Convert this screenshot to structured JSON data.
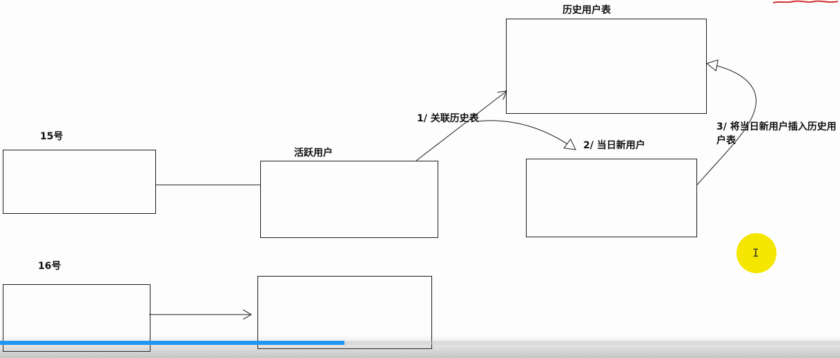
{
  "diagram": {
    "labels": {
      "day15": "15号",
      "day16": "16号",
      "active_users": "活跃用户",
      "history_table": "历史用户表",
      "step1": "1/ 关联历史表",
      "step2": "2/ 当日新用户",
      "step3": "3/ 将当日新用户插入历史用户表"
    },
    "colors": {
      "line": "#1a1a1a",
      "cursor_highlight": "#f5e600",
      "progress": "#2196f3",
      "corner_mark": "#d32f2f"
    }
  },
  "overlay": {
    "cursor_icon": "i-beam-cursor-icon",
    "cursor_glyph": "I",
    "progress_fraction": 0.41
  }
}
